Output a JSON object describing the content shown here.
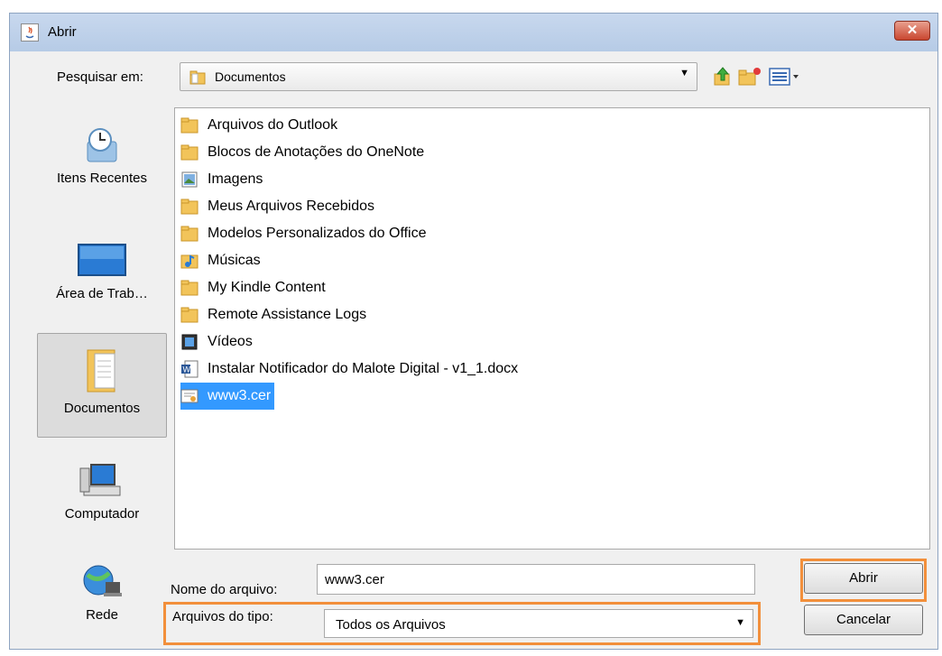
{
  "window": {
    "title": "Abrir",
    "close_label": "✕"
  },
  "lookin": {
    "label": "Pesquisar em:",
    "value": "Documentos"
  },
  "places": [
    {
      "label": "Itens Recentes",
      "icon": "recent-items-icon"
    },
    {
      "label": "Área de Trab…",
      "icon": "desktop-icon"
    },
    {
      "label": "Documentos",
      "icon": "documents-icon",
      "selected": true
    },
    {
      "label": "Computador",
      "icon": "computer-icon"
    },
    {
      "label": "Rede",
      "icon": "network-icon"
    }
  ],
  "files": [
    {
      "name": "Arquivos do Outlook",
      "icon": "folder-icon"
    },
    {
      "name": "Blocos de Anotações do OneNote",
      "icon": "folder-icon"
    },
    {
      "name": "Imagens",
      "icon": "pictures-folder-icon"
    },
    {
      "name": "Meus Arquivos Recebidos",
      "icon": "folder-icon"
    },
    {
      "name": "Modelos Personalizados do Office",
      "icon": "folder-icon"
    },
    {
      "name": "Músicas",
      "icon": "music-folder-icon"
    },
    {
      "name": "My Kindle Content",
      "icon": "folder-icon"
    },
    {
      "name": "Remote Assistance Logs",
      "icon": "folder-icon"
    },
    {
      "name": "Vídeos",
      "icon": "videos-folder-icon"
    },
    {
      "name": "Instalar Notificador do Malote Digital - v1_1.docx",
      "icon": "word-document-icon"
    },
    {
      "name": "www3.cer",
      "icon": "certificate-icon",
      "selected": true
    }
  ],
  "filename": {
    "label": "Nome do arquivo:",
    "value": "www3.cer"
  },
  "filetype": {
    "label": "Arquivos do tipo:",
    "value": "Todos os Arquivos"
  },
  "buttons": {
    "open": "Abrir",
    "cancel": "Cancelar"
  },
  "colors": {
    "highlight": "#f28f3b",
    "selection": "#3399ff",
    "folder": "#f2c45a"
  }
}
